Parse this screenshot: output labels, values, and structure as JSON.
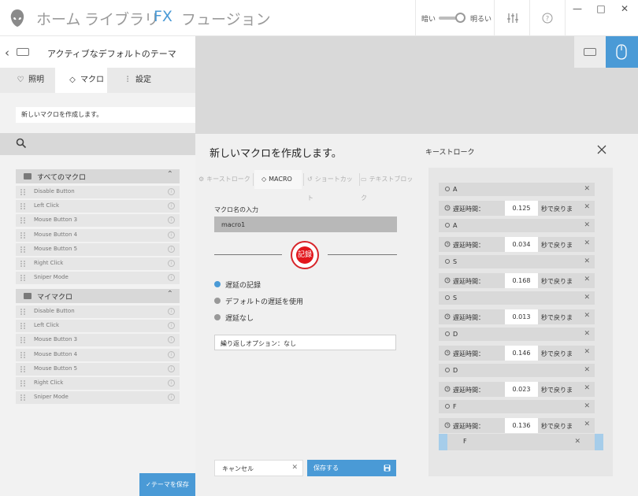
{
  "nav": {
    "home": "ホーム",
    "library": "ライブラリ",
    "fx": "FX",
    "fusion": "フュージョン"
  },
  "brightness": {
    "dark_label": "暗い",
    "bright_label": "明るい",
    "level": 0.75
  },
  "window": {
    "minimize": "—",
    "maximize": "□",
    "close": "✕"
  },
  "theme": {
    "title": "アクティブなデフォルトのテーマ"
  },
  "left_tabs": [
    {
      "label": "照明",
      "icon": "bulb-icon"
    },
    {
      "label": "マクロ",
      "icon": "layers-icon"
    },
    {
      "label": "設定",
      "icon": "sliders-icon"
    }
  ],
  "macro_info": "新しいマクロを作成します。",
  "groups": [
    {
      "label": "すべてのマクロ",
      "items": [
        "Disable Button",
        "Left Click",
        "Mouse Button 3",
        "Mouse Button 4",
        "Mouse Button 5",
        "Right Click",
        "Sniper Mode"
      ]
    },
    {
      "label": "マイマクロ",
      "items": [
        "Disable Button",
        "Left Click",
        "Mouse Button 3",
        "Mouse Button 4",
        "Mouse Button 5",
        "Right Click",
        "Sniper Mode"
      ]
    }
  ],
  "save_theme": "✓テーマを保存",
  "dialog": {
    "title": "新しいマクロを作成します。",
    "keystroke_title": "キーストローク",
    "tabs": [
      {
        "label": "キーストローク",
        "icon": "gear-icon"
      },
      {
        "label": "MACRO",
        "icon": "layers-icon"
      },
      {
        "label": "ショートカット",
        "icon": "shortcut-icon"
      },
      {
        "label": "テキストブロック",
        "icon": "textblock-icon"
      }
    ],
    "macro_name_label": "マクロ名の入力",
    "macro_name_value": "macro1",
    "record_label": "記録",
    "radios": [
      {
        "label": "遅延の記録",
        "selected": true
      },
      {
        "label": "デフォルトの遅延を使用",
        "selected": false
      },
      {
        "label": "遅延なし",
        "selected": false
      }
    ],
    "repeat_option": "繰り返しオプション：なし",
    "cancel_label": "キャンセル",
    "save_label": "保存する"
  },
  "keystrokes": [
    {
      "type": "key",
      "key": "A"
    },
    {
      "type": "delay",
      "label": "遅延時間：",
      "value": "0.125",
      "suffix": "秒で戻りま"
    },
    {
      "type": "key",
      "key": "A"
    },
    {
      "type": "delay",
      "label": "遅延時間：",
      "value": "0.034",
      "suffix": "秒で戻りま"
    },
    {
      "type": "key",
      "key": "S"
    },
    {
      "type": "delay",
      "label": "遅延時間：",
      "value": "0.168",
      "suffix": "秒で戻りま"
    },
    {
      "type": "key",
      "key": "S"
    },
    {
      "type": "delay",
      "label": "遅延時間：",
      "value": "0.013",
      "suffix": "秒で戻りま"
    },
    {
      "type": "key",
      "key": "D"
    },
    {
      "type": "delay",
      "label": "遅延時間：",
      "value": "0.146",
      "suffix": "秒で戻りま"
    },
    {
      "type": "key",
      "key": "D"
    },
    {
      "type": "delay",
      "label": "遅延時間：",
      "value": "0.023",
      "suffix": "秒で戻りま"
    },
    {
      "type": "key",
      "key": "F"
    },
    {
      "type": "delay",
      "label": "遅延時間：",
      "value": "0.136",
      "suffix": "秒で戻りま"
    }
  ],
  "selected_keystroke": {
    "key": "F"
  },
  "colors": {
    "accent": "#4a9ad6",
    "record": "#e2161c"
  }
}
